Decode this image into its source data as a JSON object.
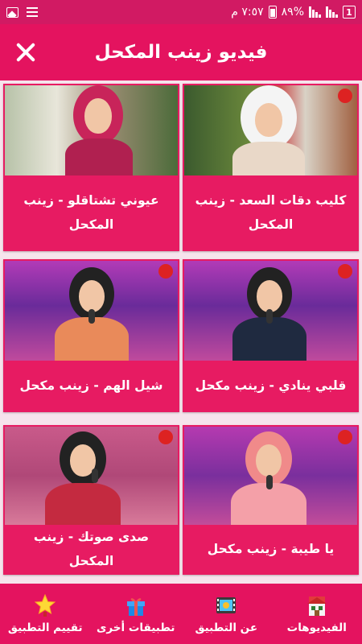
{
  "status_bar": {
    "time": "٧:٥٧ م",
    "battery_percent": "%٨٩",
    "sim_badge": "1"
  },
  "app_bar": {
    "title": "فيديو زينب المكحل"
  },
  "videos": [
    {
      "title": "كليب دقات السعد - زينب المكحل",
      "thumb_icon": "video-thumbnail"
    },
    {
      "title": "عيوني تشتاقلو - زينب المكحل",
      "thumb_icon": "video-thumbnail"
    },
    {
      "title": "قلبي ينادي - زينب مكحل",
      "thumb_icon": "video-thumbnail"
    },
    {
      "title": "شيل الهم - زينب مكحل",
      "thumb_icon": "video-thumbnail"
    },
    {
      "title": "يا طيبة - زينب مكحل",
      "thumb_icon": "video-thumbnail"
    },
    {
      "title": "صدى صوتك - زينب المكحل",
      "thumb_icon": "video-thumbnail"
    }
  ],
  "bottom_nav": [
    {
      "label": "الفيديوهات",
      "icon": "house-icon"
    },
    {
      "label": "عن التطبيق",
      "icon": "film-icon"
    },
    {
      "label": "تطبيقات أخرى",
      "icon": "gift-icon"
    },
    {
      "label": "تقييم التطبيق",
      "icon": "star-icon"
    }
  ],
  "colors": {
    "primary": "#e4135f",
    "status_bar": "#d11a63",
    "background": "#f6e3ec"
  }
}
